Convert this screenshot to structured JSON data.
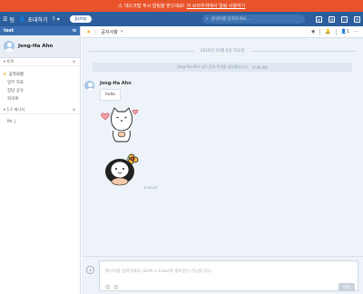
{
  "banner": {
    "text": "데스크탑 푸시 알림을 받으세요!",
    "link": "이 브라우저에서 알림 사용하기",
    "icon": "warning-icon"
  },
  "topbar": {
    "menu_label": "팀",
    "invite_label": "초대하기",
    "help_label": "?",
    "jump_label": "Jump",
    "search_placeholder": "검색어를 입력하세요...",
    "icons": [
      "file-icon",
      "mention-icon",
      "star-icon",
      "settings-icon"
    ]
  },
  "sidebar": {
    "workspace": "test",
    "user_name": "Jong-Ha Ahn",
    "topics_header": "토픽",
    "topics": [
      {
        "label": "공지사항",
        "starred": true
      },
      {
        "label": "업무 자료",
        "starred": false
      },
      {
        "label": "잡담 공유",
        "starred": false
      },
      {
        "label": "회의록",
        "starred": false
      }
    ],
    "dm_header": "1:1 메시지",
    "dms": [
      {
        "label": "Mr. J"
      }
    ]
  },
  "channel": {
    "title": "공지사항",
    "member_count": "1"
  },
  "messages": {
    "date": "2016년 10월 6일 목요일",
    "system": "Jong-Ha Ahn 님이 공개 토픽을 생성했습니다.",
    "system_time": "8:36 AM",
    "author": "Jong-Ha Ahn",
    "text": "hello",
    "time": "8:36 AM"
  },
  "composer": {
    "placeholder": "메시지를 입력하세요 (Shift + Enter로 줄바꿈이 가능합니다)",
    "send_label": "전송"
  },
  "colors": {
    "banner": "#e9532a",
    "topbar": "#2c5e9d",
    "accent": "#3a6fb3",
    "star": "#f2b01e"
  }
}
